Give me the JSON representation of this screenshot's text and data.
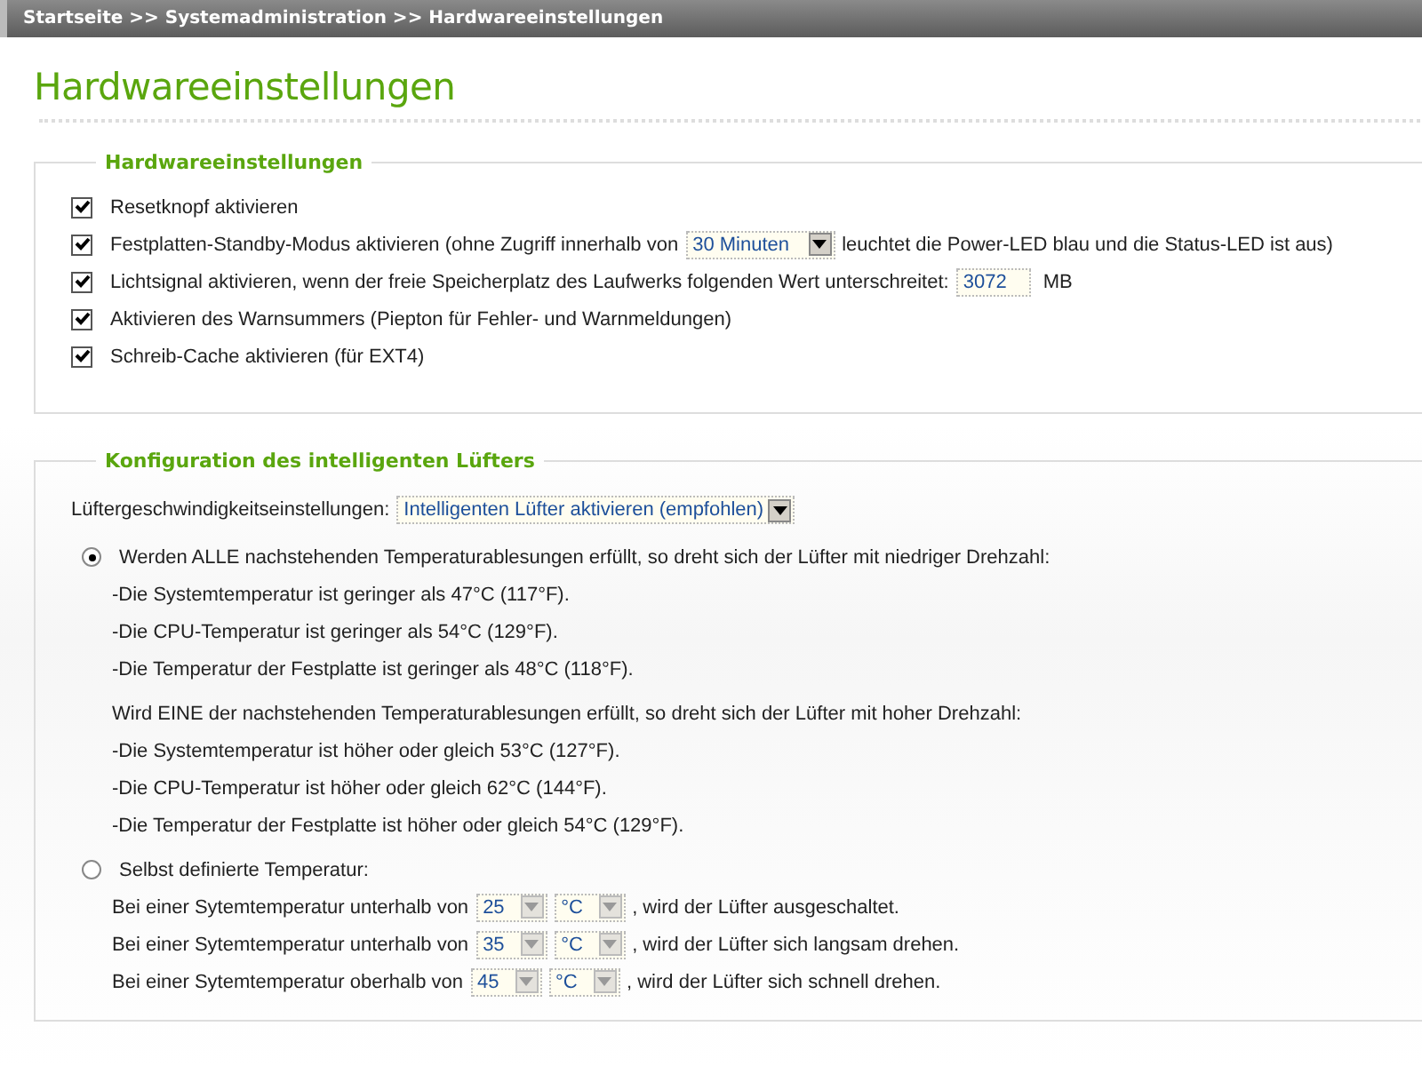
{
  "breadcrumb": "Startseite >> Systemadministration >> Hardwareeinstellungen",
  "title": "Hardwareeinstellungen",
  "hardware": {
    "legend": "Hardwareeinstellungen",
    "options": [
      {
        "kind": "plain",
        "checked": true,
        "label": "Resetknopf aktivieren"
      },
      {
        "kind": "select",
        "checked": true,
        "before": "Festplatten-Standby-Modus aktivieren (ohne Zugriff innerhalb von",
        "value": "30 Minuten",
        "after": "leuchtet die Power-LED blau und die Status-LED ist aus)"
      },
      {
        "kind": "input",
        "checked": true,
        "before": "Lichtsignal aktivieren, wenn der freie Speicherplatz des Laufwerks folgenden Wert unterschreitet:",
        "value": "3072",
        "after": "MB"
      },
      {
        "kind": "plain",
        "checked": true,
        "label": "Aktivieren des Warnsummers (Piepton für Fehler- und Warnmeldungen)"
      },
      {
        "kind": "plain",
        "checked": true,
        "label": "Schreib-Cache aktivieren (für EXT4)"
      }
    ]
  },
  "fan": {
    "legend": "Konfiguration des intelligenten Lüfters",
    "speed_label": "Lüftergeschwindigkeitseinstellungen:",
    "speed_value": "Intelligenten Lüfter aktivieren (empfohlen)",
    "modes": [
      {
        "kind": "text",
        "selected": true,
        "label": "Werden ALLE nachstehenden Temperaturablesungen erfüllt, so dreht sich der Lüfter mit niedriger Drehzahl:",
        "lines": [
          "-Die Systemtemperatur ist geringer als 47°C (117°F).",
          "-Die CPU-Temperatur ist geringer als 54°C (129°F).",
          "-Die Temperatur der Festplatte ist geringer als 48°C (118°F)."
        ],
        "second_label": "Wird EINE der nachstehenden Temperaturablesungen erfüllt, so dreht sich der Lüfter mit hoher Drehzahl:",
        "second_lines": [
          "-Die Systemtemperatur ist höher oder gleich 53°C (127°F).",
          "-Die CPU-Temperatur ist höher oder gleich 62°C (144°F).",
          "-Die Temperatur der Festplatte ist höher oder gleich 54°C (129°F)."
        ]
      },
      {
        "kind": "rules",
        "selected": false,
        "label": "Selbst definierte Temperatur:",
        "rules": [
          {
            "before": "Bei einer Sytemtemperatur unterhalb von",
            "value": "25",
            "unit": "°C",
            "after": ", wird der Lüfter ausgeschaltet.",
            "disabled": true
          },
          {
            "before": "Bei einer Sytemtemperatur unterhalb von",
            "value": "35",
            "unit": "°C",
            "after": ", wird der Lüfter sich langsam drehen.",
            "disabled": true
          },
          {
            "before": "Bei einer Sytemtemperatur oberhalb von",
            "value": "45",
            "unit": "°C",
            "after": ", wird der Lüfter sich schnell drehen.",
            "disabled": true
          }
        ]
      }
    ]
  }
}
